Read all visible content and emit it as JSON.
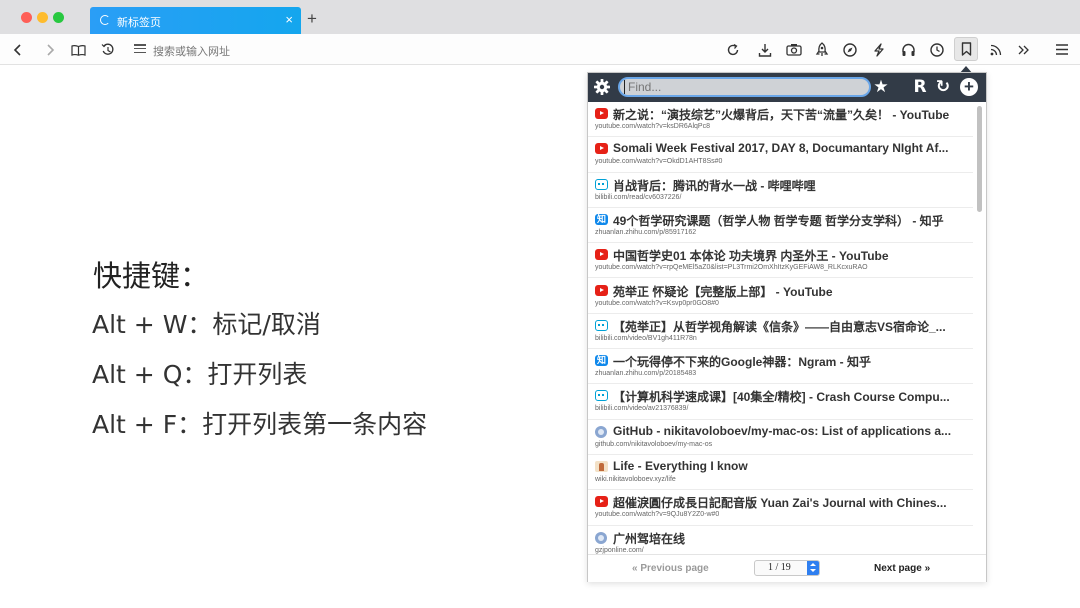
{
  "tab": {
    "title": "新标签页",
    "close": "×",
    "new_tab": "+"
  },
  "address_bar": {
    "placeholder": "搜索或输入网址"
  },
  "toolbar_icons": [
    "back-icon",
    "forward-icon",
    "reader-icon",
    "history-icon",
    "reload-icon",
    "download-icon",
    "camera-icon",
    "rocket-icon",
    "compass-icon",
    "lightning-icon",
    "headphones-icon",
    "clock-icon",
    "bookmark-icon",
    "rss-icon",
    "more-icon",
    "menu-icon"
  ],
  "shortcuts": {
    "title": "快捷键：",
    "lines": [
      "Alt + W：标记/取消",
      "Alt + Q：打开列表",
      "Alt + F：打开列表第一条内容"
    ]
  },
  "popup": {
    "find_placeholder": "Find...",
    "buttons": {
      "star": "★",
      "random": "R",
      "sync": "↻",
      "add": "+"
    },
    "items": [
      {
        "icon": "youtube",
        "title": "新之说：“演技综艺”火爆背后，天下苦“流量”久矣！ - YouTube",
        "url": "youtube.com/watch?v=ksDR6AlqPc8"
      },
      {
        "icon": "youtube",
        "title": "Somali Week Festival 2017, DAY 8, Documantary NIght Af...",
        "url": "youtube.com/watch?v=OkdD1AHT8Ss#0"
      },
      {
        "icon": "bilibili",
        "title": "肖战背后：腾讯的背水一战 - 哔哩哔哩",
        "url": "bilibili.com/read/cv6037226/"
      },
      {
        "icon": "zhihu",
        "title": "49个哲学研究课题（哲学人物 哲学专题 哲学分支学科） - 知乎",
        "url": "zhuanlan.zhihu.com/p/85917162"
      },
      {
        "icon": "youtube",
        "title": "中国哲学史01 本体论 功夫境界 内圣外王 - YouTube",
        "url": "youtube.com/watch?v=rpQeMEl5aZ0&list=PL3Trmi2OmXhItzKyGEFiAW8_RLKcxuRAO"
      },
      {
        "icon": "youtube",
        "title": "苑举正 怀疑论【完整版上部】 - YouTube",
        "url": "youtube.com/watch?v=Ksvp0pr0GO8#0"
      },
      {
        "icon": "bilibili",
        "title": "【苑举正】从哲学视角解读《信条》——自由意志VS宿命论_...",
        "url": "bilibili.com/video/BV1gh411R78n"
      },
      {
        "icon": "zhihu",
        "title": "一个玩得停不下来的Google神器：Ngram - 知乎",
        "url": "zhuanlan.zhihu.com/p/20185483"
      },
      {
        "icon": "bilibili",
        "title": "【计算机科学速成课】[40集全/精校] - Crash Course Compu...",
        "url": "bilibili.com/video/av21376839/"
      },
      {
        "icon": "github",
        "title": "GitHub - nikitavoloboev/my-mac-os: List of applications a...",
        "url": "github.com/nikitavoloboev/my-mac-os"
      },
      {
        "icon": "wiki",
        "title": "Life - Everything I know",
        "url": "wiki.nikitavoloboev.xyz/life"
      },
      {
        "icon": "youtube",
        "title": "超催淚圓仔成長日記配音版 Yuan Zai's Journal with Chines...",
        "url": "youtube.com/watch?v=9QJu8Y2Z0-w#0"
      },
      {
        "icon": "github",
        "title": "广州驾培在线",
        "url": "gzjponline.com/"
      }
    ],
    "footer": {
      "previous": "« Previous page",
      "page": "1 / 19",
      "next": "Next page »"
    }
  },
  "colors": {
    "tab_accent": "#1aa3f0",
    "popup_header": "#323b47",
    "youtube": "#e62117",
    "bilibili": "#00a1d6",
    "zhihu": "#0f88eb"
  }
}
